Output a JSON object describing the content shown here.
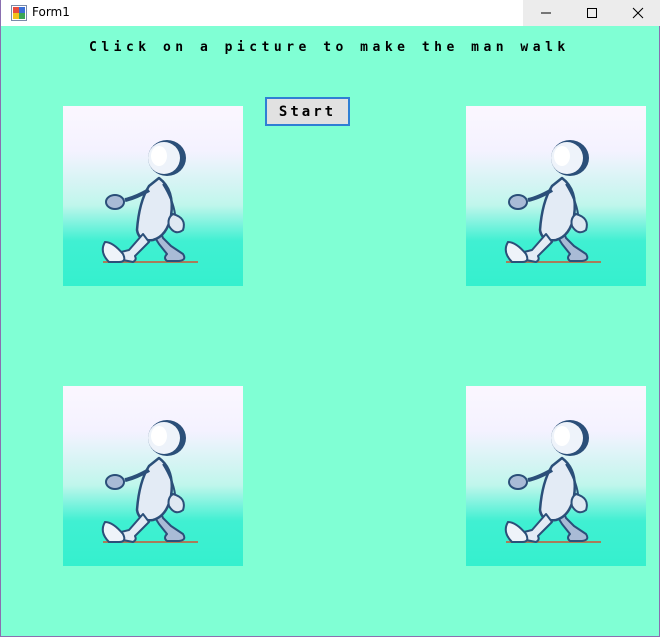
{
  "window": {
    "title": "Form1",
    "icon": "winforms-app-icon",
    "controls": [
      "minimize-icon",
      "maximize-icon",
      "close-icon"
    ]
  },
  "form": {
    "instruction": "Click on a picture to make the man walk",
    "start_label": "Start"
  },
  "pictures": [
    {
      "name": "walker-picture-top-left",
      "icon": "walking-man"
    },
    {
      "name": "walker-picture-top-right",
      "icon": "walking-man"
    },
    {
      "name": "walker-picture-bottom-left",
      "icon": "walking-man"
    },
    {
      "name": "walker-picture-bottom-right",
      "icon": "walking-man"
    }
  ],
  "colors": {
    "client_background": "#80FFD4",
    "picture_gradient_top": "#FBF7FF",
    "picture_gradient_bottom": "#35F0CE",
    "button_border": "#2F7FD4"
  }
}
